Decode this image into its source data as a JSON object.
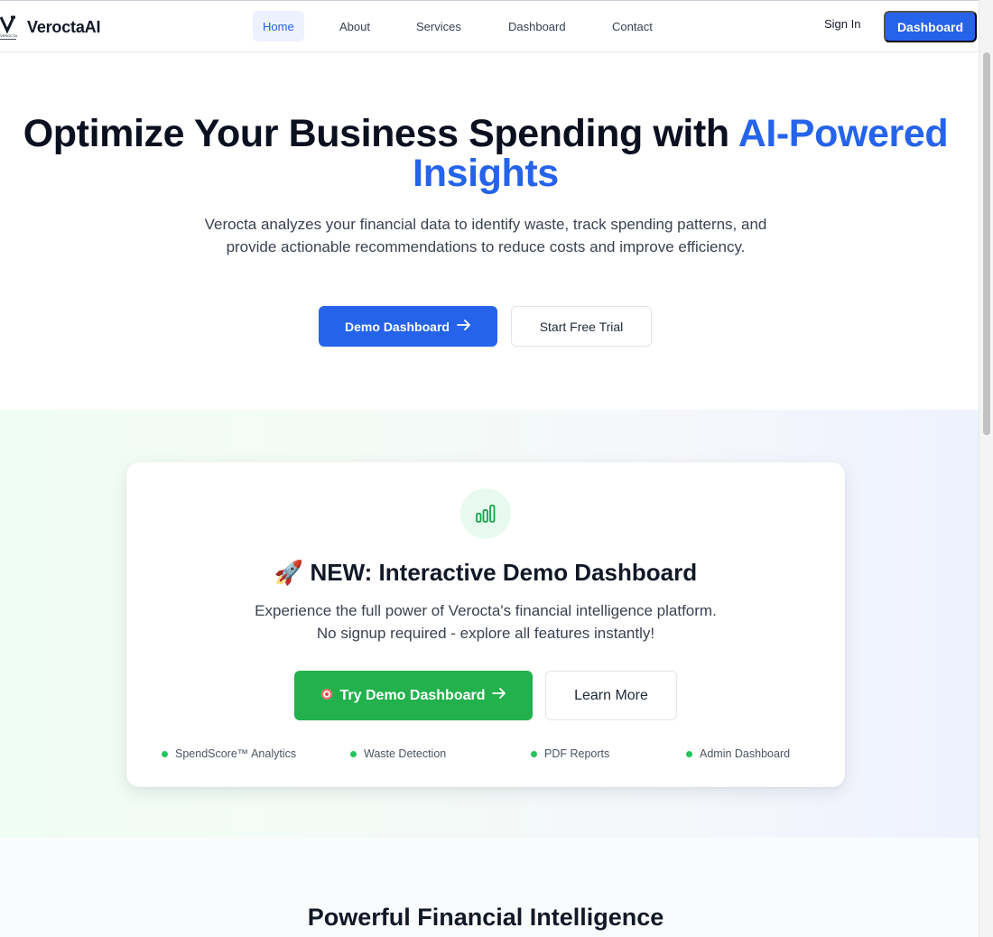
{
  "nav": {
    "brand": "VeroctaAI",
    "logo_text": "VEROCTA",
    "links": [
      "Home",
      "About",
      "Services",
      "Dashboard",
      "Contact"
    ],
    "active_link": "Home",
    "sign_in": "Sign In",
    "cta": "Dashboard"
  },
  "hero": {
    "title_main": "Optimize Your Business Spending with",
    "title_accent": "AI-Powered Insights",
    "subtitle": "Verocta analyzes your financial data to identify waste, track spending patterns, and provide actionable recommendations to reduce costs and improve efficiency.",
    "primary_button": "Demo Dashboard",
    "secondary_button": "Start Free Trial"
  },
  "demo": {
    "icon": "bar-chart-icon",
    "title_emoji": "🚀",
    "title": "NEW: Interactive Demo Dashboard",
    "subtitle_line1": "Experience the full power of Verocta's financial intelligence platform.",
    "subtitle_line2": "No signup required - explore all features instantly!",
    "try_button": "Try Demo Dashboard",
    "try_button_icon": "target-icon",
    "learn_button": "Learn More",
    "features": [
      "SpendScore™ Analytics",
      "Waste Detection",
      "PDF Reports",
      "Admin Dashboard"
    ]
  },
  "section_title": "Powerful Financial Intelligence",
  "colors": {
    "primary": "#2563eb",
    "green": "#22b14c",
    "feature_dot": "#22c55e",
    "text_dark": "#111827",
    "text_muted": "#3b4251"
  }
}
